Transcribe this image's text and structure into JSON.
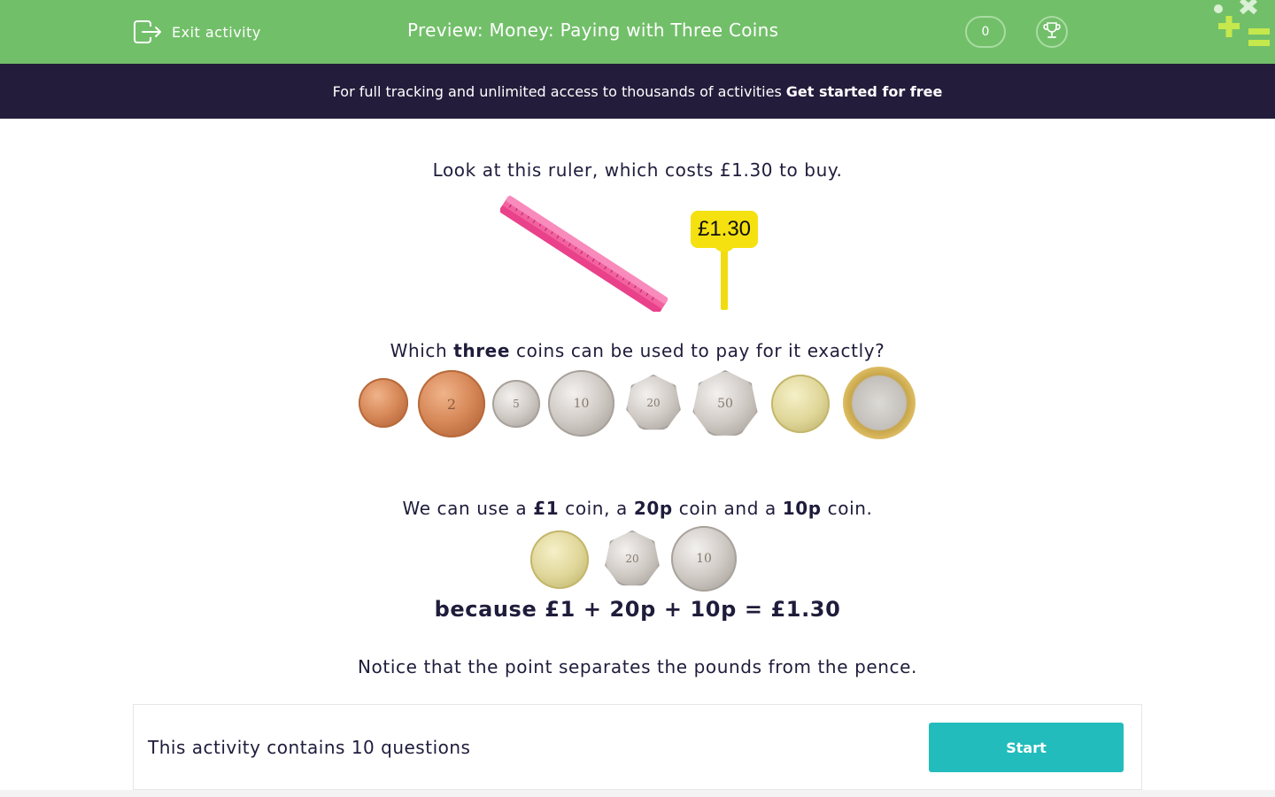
{
  "header": {
    "exit_label": "Exit activity",
    "title": "Preview: Money: Paying with Three Coins",
    "score": "0",
    "bar_color": "#72bf6a",
    "icons": [
      "exit-icon",
      "trophy-icon"
    ]
  },
  "promo": {
    "text": "For full tracking and unlimited access to thousands of activities",
    "cta": "Get started for free",
    "bg_color": "#241c3b"
  },
  "content": {
    "intro": "Look at this ruler, which costs £1.30 to buy.",
    "price_tag": "£1.30",
    "question_pre": "Which ",
    "question_bold": "three",
    "question_post": " coins can be used to pay for it exactly?",
    "coins": [
      {
        "name": "1p",
        "label": ""
      },
      {
        "name": "2p",
        "label": "2"
      },
      {
        "name": "5p",
        "label": "5"
      },
      {
        "name": "10p",
        "label": "10"
      },
      {
        "name": "20p",
        "label": "20"
      },
      {
        "name": "50p",
        "label": "50"
      },
      {
        "name": "£1",
        "label": ""
      },
      {
        "name": "£2",
        "label": ""
      }
    ],
    "answer_parts": [
      "We can use a ",
      "£1",
      " coin, a ",
      "20p",
      " coin and a ",
      "10p",
      " coin."
    ],
    "answer_coins": [
      {
        "name": "£1",
        "label": ""
      },
      {
        "name": "20p",
        "label": "20"
      },
      {
        "name": "10p",
        "label": "10"
      }
    ],
    "equation": "because £1 + 20p + 10p = £1.30",
    "notice": "Notice that the point separates the pounds from the pence."
  },
  "footer": {
    "questions_text": "This activity contains 10 questions",
    "start_label": "Start",
    "start_color": "#23bcbc"
  }
}
